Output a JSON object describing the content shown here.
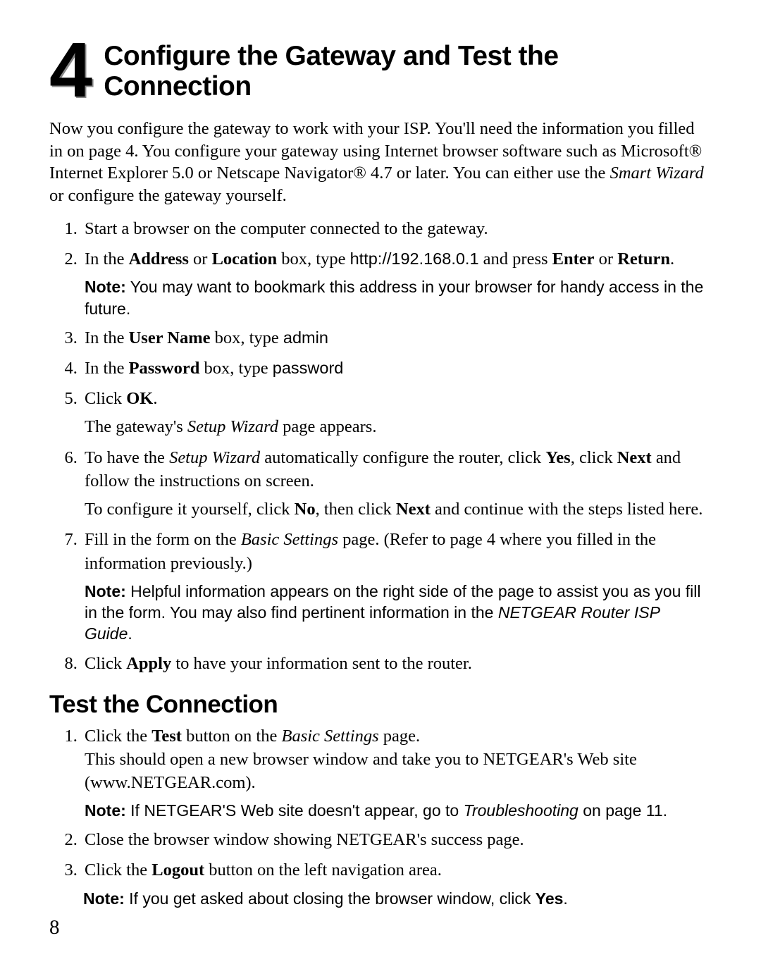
{
  "section": {
    "number": "4",
    "title": "Configure the Gateway and Test the Connection"
  },
  "intro": {
    "text_a": "Now you configure the gateway to work with your ISP. You'll need the information you filled in on page 4. You configure your gateway using Internet browser software such as Microsoft® Internet Explorer 5.0 or Netscape Navigator® 4.7 or later. You can either use the ",
    "smart_wizard": "Smart Wizard",
    "text_b": " or configure the gateway yourself."
  },
  "steps_a": {
    "s1": "Start a browser on the computer connected to the gateway.",
    "s2": {
      "a": "In the ",
      "b": "Address",
      "c": " or ",
      "d": "Location",
      "e": " box, type ",
      "url": "http://192.168.0.1",
      "f": " and press ",
      "g": "Enter",
      "h": " or ",
      "i": "Return",
      "j": ".",
      "note_label": "Note:",
      "note_text": " You may want to bookmark this address in your browser for handy access in the future."
    },
    "s3": {
      "a": "In the ",
      "b": "User Name",
      "c": " box, type ",
      "d": "admin"
    },
    "s4": {
      "a": "In the ",
      "b": "Password",
      "c": " box, type ",
      "d": "password"
    },
    "s5": {
      "a": "Click ",
      "b": "OK",
      "c": ".",
      "sub_a": "The gateway's ",
      "sub_b": "Setup Wizard",
      "sub_c": " page appears."
    },
    "s6": {
      "a": "To have the ",
      "b": "Setup Wizard",
      "c": " automatically configure the router, click ",
      "d": "Yes",
      "e": ", click ",
      "f": "Next",
      "g": " and follow the instructions on screen.",
      "sub_a": "To configure it yourself, click ",
      "sub_b": "No",
      "sub_c": ", then click ",
      "sub_d": "Next",
      "sub_e": " and continue with the steps listed here."
    },
    "s7": {
      "a": "Fill in the form on the ",
      "b": "Basic Settings",
      "c": " page. (Refer to page 4 where you filled in the information previously.)",
      "note_label": "Note:",
      "note_text_a": " Helpful information appears on the right side of the page to assist you as you fill in the form. You may also find pertinent information in the ",
      "note_italic": "NETGEAR Router ISP Guide",
      "note_text_b": "."
    },
    "s8": {
      "a": "Click ",
      "b": "Apply",
      "c": " to have your information sent to the router."
    }
  },
  "subhead": "Test the Connection",
  "steps_b": {
    "s1": {
      "a": "Click the ",
      "b": "Test",
      "c": " button on the ",
      "d": "Basic Settings",
      "e": " page.",
      "sub": "This should open a new browser window and take you to NETGEAR's Web site (www.NETGEAR.com).",
      "note_label": "Note:",
      "note_text_a": " If NETGEAR'S Web site doesn't appear, go to ",
      "note_italic": "Troubleshooting",
      "note_text_b": " on page 11."
    },
    "s2": "Close the browser window showing NETGEAR's success page.",
    "s3": {
      "a": "Click the ",
      "b": "Logout",
      "c": " button on the left navigation area."
    }
  },
  "footer_note": {
    "label": "Note:",
    "a": " If you get asked about closing the browser window, click ",
    "b": "Yes",
    "c": "."
  },
  "page_number": "8"
}
